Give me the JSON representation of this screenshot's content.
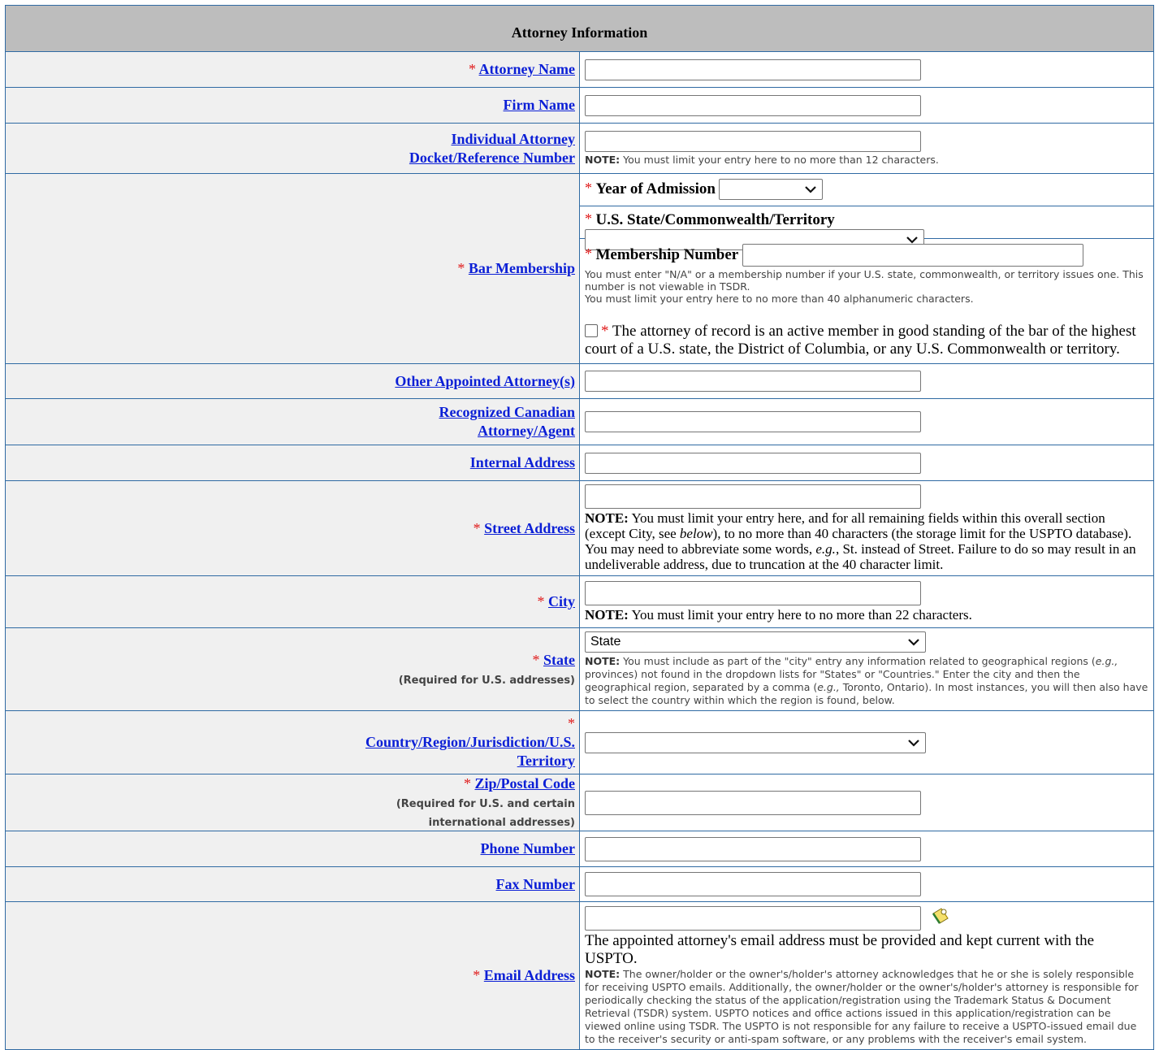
{
  "section_title": "Attorney Information",
  "required_marker": "*",
  "fields": {
    "attorney_name": {
      "label": "Attorney Name",
      "value": ""
    },
    "firm_name": {
      "label": "Firm Name",
      "value": ""
    },
    "docket": {
      "label_line1": "Individual Attorney",
      "label_line2": "Docket/Reference Number",
      "value": "",
      "note_bold": "NOTE:",
      "note_text": " You must limit your entry here to no more than 12 characters."
    },
    "bar_membership": {
      "label": "Bar Membership",
      "year_label": "Year of Admission",
      "year_value": "",
      "state_label": "U.S. State/Commonwealth/Territory",
      "state_value": "",
      "number_label": "Membership Number",
      "number_value": "",
      "number_note_line1": "You must enter \"N/A\" or a membership number if your U.S. state, commonwealth, or territory issues one. This number is not viewable in TSDR.",
      "number_note_line2": "You must limit your entry here to no more than 40 alphanumeric characters.",
      "attest_text": "The attorney of record is an active member in good standing of the bar of the highest court of a U.S. state, the District of Columbia, or any U.S. Commonwealth or territory.",
      "attest_checked": false
    },
    "other_attorneys": {
      "label": "Other Appointed Attorney(s)",
      "value": ""
    },
    "canadian": {
      "label_line1": "Recognized Canadian",
      "label_line2": "Attorney/Agent",
      "value": ""
    },
    "internal_address": {
      "label": "Internal Address",
      "value": ""
    },
    "street_address": {
      "label": "Street Address",
      "value": "",
      "note_bold": "NOTE:",
      "note_part1": " You must limit your entry here, and for all remaining fields within this overall section (except City, see ",
      "note_italic1": "below",
      "note_part2": "), to no more than 40 characters (the storage limit for the USPTO database). You may need to abbreviate some words, ",
      "note_italic2": "e.g.",
      "note_part3": ", St. instead of Street. Failure to do so may result in an undeliverable address, due to truncation at the 40 character limit."
    },
    "city": {
      "label": "City",
      "value": "",
      "note_bold": "NOTE:",
      "note_text": " You must limit your entry here to no more than 22 characters."
    },
    "state": {
      "label": "State",
      "sublabel": "(Required for U.S. addresses)",
      "value": "State",
      "note_bold": "NOTE:",
      "note_part1": " You must include as part of the \"city\" entry any information related to geographical regions (",
      "note_italic1": "e.g.,",
      "note_part2": " provinces) not found in the dropdown lists for \"States\" or \"Countries.\" Enter the city and then the geographical region, separated by a comma (",
      "note_italic2": "e.g.,",
      "note_part3": " Toronto, Ontario). In most instances, you will then also have to select the country within which the region is found, below."
    },
    "country": {
      "label_line1": "Country/Region/Jurisdiction/U.S.",
      "label_line2": "Territory",
      "value": ""
    },
    "zip": {
      "label": "Zip/Postal Code",
      "sublabel_line1": "(Required for U.S. and certain",
      "sublabel_line2": "international addresses)",
      "value": ""
    },
    "phone": {
      "label": "Phone Number",
      "value": ""
    },
    "fax": {
      "label": "Fax Number",
      "value": ""
    },
    "email": {
      "label": "Email Address",
      "value": "",
      "notice": "The appointed attorney's email address must be provided and kept current with the USPTO.",
      "note_bold": "NOTE:",
      "note_text": " The owner/holder or the owner's/holder's attorney acknowledges that he or she is solely responsible for receiving USPTO emails. Additionally, the owner/holder or the owner's/holder's attorney is responsible for periodically checking the status of the application/registration using the Trademark Status & Document Retrieval (TSDR) system. USPTO notices and office actions issued in this application/registration can be viewed online using TSDR. The USPTO is not responsible for any failure to receive a USPTO-issued email due to the receiver's security or anti-spam software, or any problems with the receiver's email system."
    }
  },
  "colors": {
    "header_bg": "#bdbdbd",
    "label_bg": "#f0f0f0",
    "link": "#0b1fd6",
    "required": "#e01b1b",
    "border": "#2f6aa3"
  },
  "icons": {
    "email_validate": "email-check-icon",
    "dropdown": "chevron-down-icon"
  }
}
